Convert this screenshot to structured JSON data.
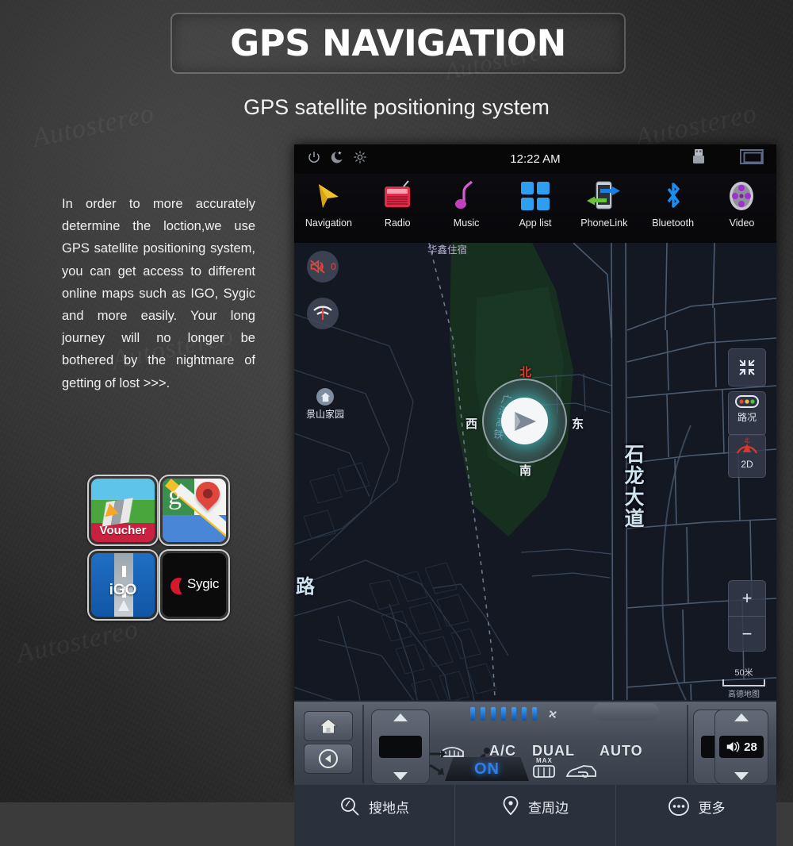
{
  "header": {
    "title": "GPS NAVIGATION",
    "subtitle": "GPS satellite positioning system"
  },
  "body_copy": "In order to more accurately determine the loction,we use GPS satellite positioning system, you can get access to different online maps such as IGO, Sygic and more easily. Your long journey will no longer be bothered by the nightmare of getting of lost  >>>.",
  "watermark": "Autostereo",
  "app_icons": [
    {
      "name": "sygic-voucher",
      "label": "Voucher"
    },
    {
      "name": "google-maps",
      "label": "g"
    },
    {
      "name": "igo",
      "label": "iGO"
    },
    {
      "name": "sygic",
      "label": "Sygic"
    }
  ],
  "head_unit": {
    "status_bar": {
      "time": "12:22 AM",
      "left_icons": [
        "power-icon",
        "night-mode-icon",
        "brightness-icon"
      ],
      "right_icons": [
        "usb-icon",
        "display-icon"
      ]
    },
    "nav_items": [
      {
        "label": "Navigation",
        "icon": "navigation-arrow-icon"
      },
      {
        "label": "Radio",
        "icon": "radio-icon"
      },
      {
        "label": "Music",
        "icon": "music-note-icon"
      },
      {
        "label": "App list",
        "icon": "app-grid-icon"
      },
      {
        "label": "PhoneLink",
        "icon": "phone-link-icon"
      },
      {
        "label": "Bluetooth",
        "icon": "bluetooth-icon"
      },
      {
        "label": "Video",
        "icon": "video-reel-icon"
      }
    ],
    "map": {
      "mute_badge": "0",
      "poi_home": "景山家园",
      "poi_hotel": "华鑫住宿",
      "road_main": "石龙大道",
      "road_rail": "广深高铁",
      "road_edge": "路",
      "compass": {
        "north": "北",
        "south": "南",
        "west": "西",
        "east": "东"
      },
      "controls": {
        "collapse": "collapse-icon",
        "traffic_label": "路况",
        "view_label": "2D",
        "zoom_in": "+",
        "zoom_out": "−"
      },
      "scale": {
        "distance": "50米",
        "attribution": "高德地图"
      }
    },
    "map_tools": [
      {
        "label": "搜地点",
        "icon": "search-icon"
      },
      {
        "label": "查周边",
        "icon": "map-pin-icon"
      },
      {
        "label": "更多",
        "icon": "more-dots-icon"
      }
    ]
  },
  "climate_panel": {
    "home_button": "home-icon",
    "back_button": "back-arrow-icon",
    "ac_label": "A/C",
    "dual_label": "DUAL",
    "auto_label": "AUTO",
    "max_label": "MAX",
    "on_label": "ON",
    "volume_value": "28",
    "icons": [
      "defrost-front-icon",
      "airflow-icon",
      "seat-airflow-icon",
      "defrost-rear-max-icon",
      "recirculate-icon",
      "volume-icon"
    ]
  },
  "colors": {
    "page_bg": "#3b3b3b",
    "accent_blue": "#2f7fe8",
    "map_bg": "#121620",
    "toolbar_bg": "#2b303d",
    "north_red": "#e23a30"
  }
}
